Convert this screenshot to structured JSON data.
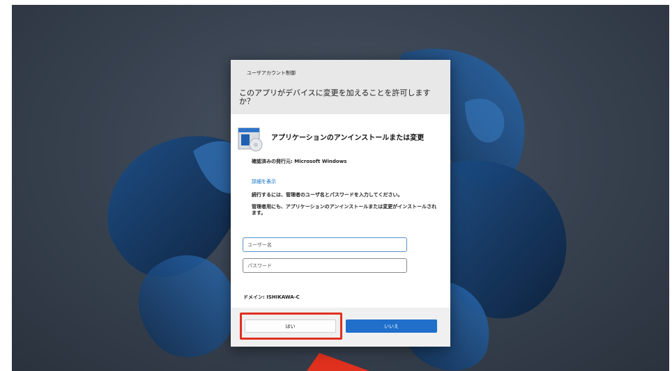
{
  "dialog": {
    "caption": "ユーザアカウント制御",
    "question": "このアプリがデバイスに変更を加えることを許可しますか？",
    "app_name": "アプリケーションのアンインストールまたは変更",
    "publisher": "確認済みの発行元: Microsoft Windows",
    "details_link": "詳細を表示",
    "instruction": "続行するには、管理者のユーザ名とパスワードを入力してください。",
    "note": "管理者用にも、アプリケーションのアンインストールまたは変更がインストールされます。",
    "username_placeholder": "ユーザー名",
    "password_placeholder": "パスワード",
    "domain": "ドメイン: ISHIKAWA-C",
    "yes_label": "はい",
    "no_label": "いいえ"
  },
  "colors": {
    "accent": "#1f6fcb",
    "link": "#0067c0",
    "highlight": "#e0301e",
    "header_bg": "#e8e8e8"
  },
  "icons": [
    "app-uninstall-icon",
    "red-arrow-annotation"
  ]
}
